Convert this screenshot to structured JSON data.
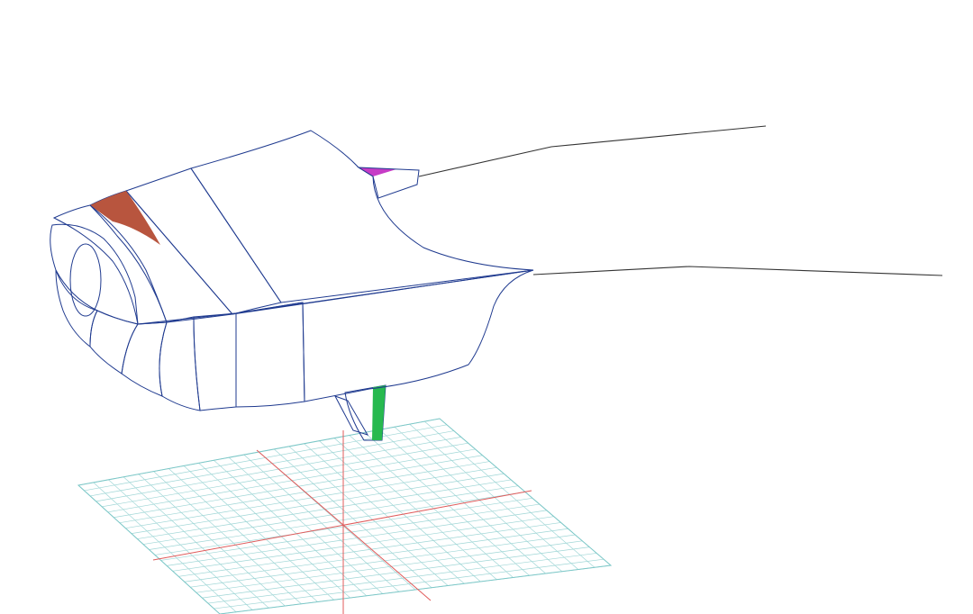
{
  "viewport": {
    "background": "#ffffff",
    "colors": {
      "magenta": "#f045f0",
      "orange": "#f7a90a",
      "yellow_orange": "#ffc000",
      "salmon": "#f07860",
      "brick": "#c85840",
      "yellow": "#fff200",
      "green": "#3ee867",
      "mint": "#78ecb0",
      "grid": "#9fd6d6",
      "axis": "#e05b5b",
      "edge": "#1f3a8f"
    },
    "grid_divisions": 24
  }
}
